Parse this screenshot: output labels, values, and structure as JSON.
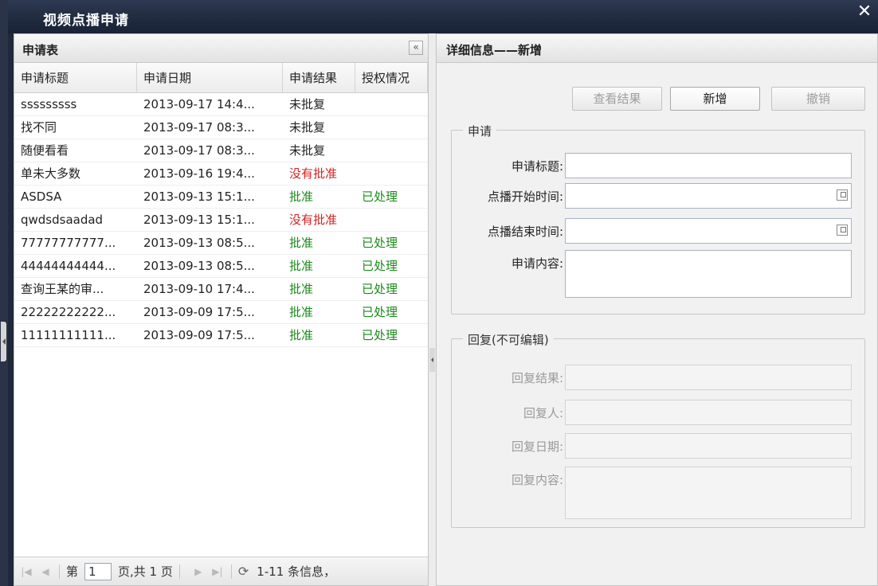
{
  "window": {
    "title": "视频点播申请",
    "close_label": "✕"
  },
  "left_panel": {
    "title": "申请表",
    "collapse_label": "«",
    "columns": [
      "申请标题",
      "申请日期",
      "申请结果",
      "授权情况"
    ],
    "rows": [
      {
        "title": "sssssssss",
        "date": "2013-09-17 14:4...",
        "result": "未批复",
        "result_status": "pending",
        "auth": ""
      },
      {
        "title": "找不同",
        "date": "2013-09-17 08:3...",
        "result": "未批复",
        "result_status": "pending",
        "auth": ""
      },
      {
        "title": "随便看看",
        "date": "2013-09-17 08:3...",
        "result": "未批复",
        "result_status": "pending",
        "auth": ""
      },
      {
        "title": "单未大多数",
        "date": "2013-09-16 19:4...",
        "result": "没有批准",
        "result_status": "rejected",
        "auth": ""
      },
      {
        "title": "ASDSA",
        "date": "2013-09-13 15:1...",
        "result": "批准",
        "result_status": "approved",
        "auth": "已处理"
      },
      {
        "title": "qwdsdsaadad",
        "date": "2013-09-13 15:1...",
        "result": "没有批准",
        "result_status": "rejected",
        "auth": ""
      },
      {
        "title": "77777777777...",
        "date": "2013-09-13 08:5...",
        "result": "批准",
        "result_status": "approved",
        "auth": "已处理"
      },
      {
        "title": "44444444444...",
        "date": "2013-09-13 08:5...",
        "result": "批准",
        "result_status": "approved",
        "auth": "已处理"
      },
      {
        "title": "查询王某的审...",
        "date": "2013-09-10 17:4...",
        "result": "批准",
        "result_status": "approved",
        "auth": "已处理"
      },
      {
        "title": "22222222222...",
        "date": "2013-09-09 17:5...",
        "result": "批准",
        "result_status": "approved",
        "auth": "已处理"
      },
      {
        "title": "11111111111...",
        "date": "2013-09-09 17:5...",
        "result": "批准",
        "result_status": "approved",
        "auth": "已处理"
      }
    ],
    "pager": {
      "page_prefix": "第",
      "page_value": "1",
      "page_suffix": "页,共 1 页",
      "info": "1-11 条信息，"
    }
  },
  "right_panel": {
    "title": "详细信息——新增",
    "buttons": {
      "view_result": "查看结果",
      "add": "新增",
      "cancel": "撤销"
    },
    "apply_group": {
      "legend": "申请",
      "title_label": "申请标题:",
      "start_label": "点播开始时间:",
      "end_label": "点播结束时间:",
      "content_label": "申请内容:"
    },
    "reply_group": {
      "legend": "回复(不可编辑)",
      "result_label": "回复结果:",
      "person_label": "回复人:",
      "date_label": "回复日期:",
      "content_label": "回复内容:"
    }
  },
  "colors": {
    "approved": "#1a8a1a",
    "rejected": "#d22222",
    "titlebar": "#1f2a3f"
  }
}
